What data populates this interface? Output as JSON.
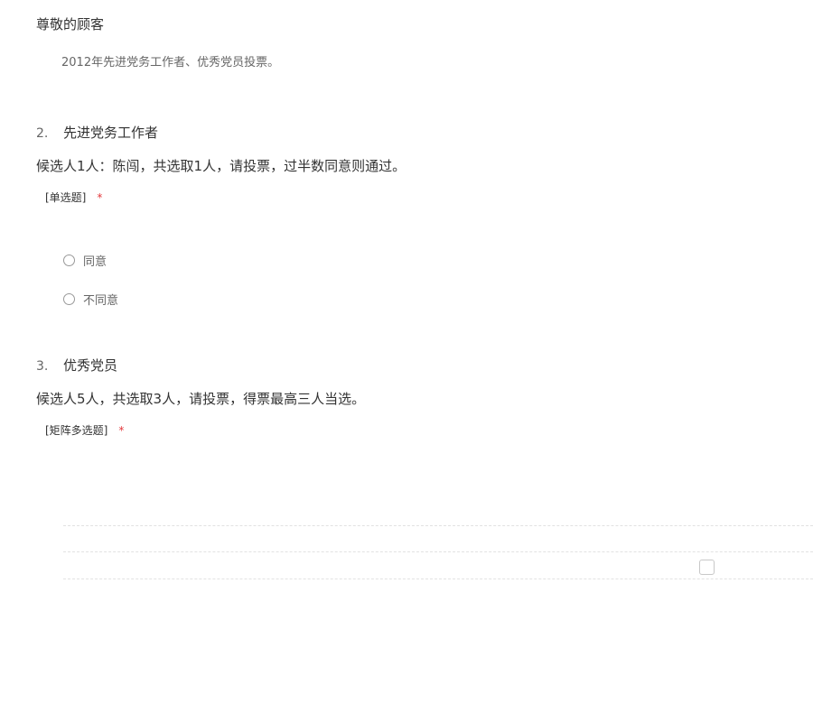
{
  "header": {
    "greeting": "尊敬的顾客",
    "intro": "2012年先进党务工作者、优秀党员投票。"
  },
  "questions": [
    {
      "number": "2.",
      "title": "先进党务工作者",
      "description": "候选人1人：陈闯，共选取1人，请投票，过半数同意则通过。",
      "type": "[单选题]",
      "required_mark": "*",
      "options": [
        "同意",
        "不同意"
      ]
    },
    {
      "number": "3.",
      "title": "优秀党员",
      "description": "候选人5人，共选取3人，请投票，得票最高三人当选。",
      "type": "[矩阵多选题]",
      "required_mark": "*"
    }
  ],
  "colors": {
    "required": "#e4393c",
    "text": "#333333",
    "muted": "#666666"
  }
}
